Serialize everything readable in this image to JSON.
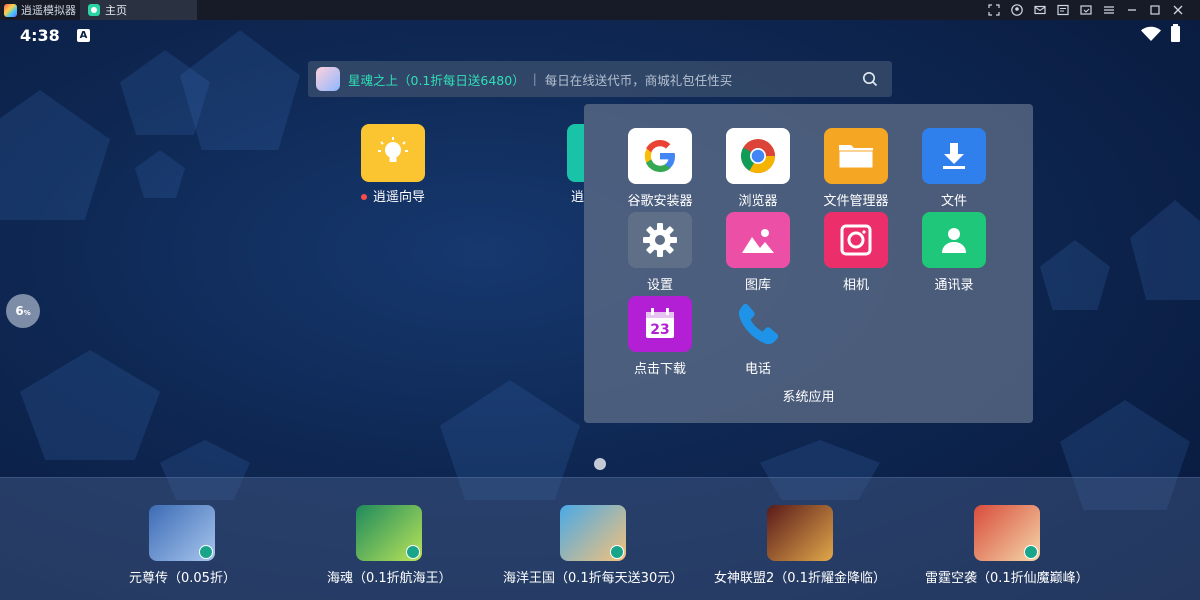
{
  "titlebar": {
    "app_name": "逍遥模拟器",
    "tab_label": "主页"
  },
  "status": {
    "time": "4:38",
    "notification": "A"
  },
  "search": {
    "promo": "星魂之上（0.1折每日送6480）",
    "separator": "|",
    "hint": "每日在线送代币，商城礼包任性买"
  },
  "desktop_icons": [
    {
      "label": "逍遥向导",
      "color": "#fbc531"
    },
    {
      "label": "逍",
      "color": "#19c3a8"
    }
  ],
  "side_widget": {
    "value": "6",
    "unit": "%"
  },
  "folder": {
    "title": "系统应用",
    "apps": [
      {
        "label": "谷歌安装器",
        "icon": "google-icon",
        "color": "#ffffff"
      },
      {
        "label": "浏览器",
        "icon": "chrome-icon",
        "color": "#ffffff"
      },
      {
        "label": "文件管理器",
        "icon": "folder-icon",
        "color": "#f5a623"
      },
      {
        "label": "文件",
        "icon": "download-icon",
        "color": "#2f80ed"
      },
      {
        "label": "设置",
        "icon": "gear-icon",
        "color": "#5f6f88"
      },
      {
        "label": "图库",
        "icon": "gallery-icon",
        "color": "#ec4fa6"
      },
      {
        "label": "相机",
        "icon": "camera-icon",
        "color": "#ec2f6b"
      },
      {
        "label": "通讯录",
        "icon": "contacts-icon",
        "color": "#1fc77a"
      },
      {
        "label": "点击下载",
        "icon": "calendar-icon",
        "color": "#b31fd4"
      },
      {
        "label": "电话",
        "icon": "phone-icon",
        "color": "#1f93e8"
      }
    ]
  },
  "calendar_number": "23",
  "dock": [
    {
      "label": "元尊传（0.05折）",
      "color1": "#3c6bb5",
      "color2": "#a8c6ee"
    },
    {
      "label": "海魂（0.1折航海王）",
      "color1": "#1e8a5c",
      "color2": "#b9e45a"
    },
    {
      "label": "海洋王国（0.1折每天送30元）",
      "color1": "#4aa9e6",
      "color2": "#f4c27a"
    },
    {
      "label": "女神联盟2（0.1折耀金降临）",
      "color1": "#5a1a1a",
      "color2": "#e0a84a"
    },
    {
      "label": "雷霆空袭（0.1折仙魔巅峰）",
      "color1": "#d94c3c",
      "color2": "#f4d7a8"
    }
  ]
}
